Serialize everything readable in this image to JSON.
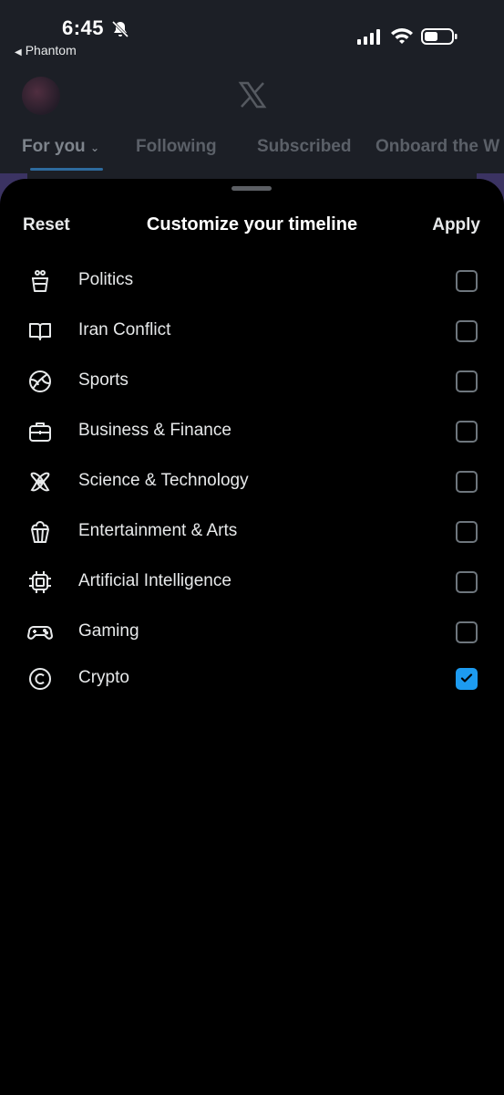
{
  "status_bar": {
    "time": "6:45",
    "back_app": "Phantom",
    "back_arrow": "◀"
  },
  "header": {
    "tabs": [
      "For you",
      "Following",
      "Subscribed",
      "Onboard the W"
    ],
    "active_tab": "For you"
  },
  "sheet": {
    "reset_label": "Reset",
    "title": "Customize your timeline",
    "apply_label": "Apply",
    "topics": [
      {
        "label": "Politics",
        "icon": "podium-icon",
        "checked": false
      },
      {
        "label": "Iran Conflict",
        "icon": "book-icon",
        "checked": false
      },
      {
        "label": "Sports",
        "icon": "ball-icon",
        "checked": false
      },
      {
        "label": "Business & Finance",
        "icon": "briefcase-icon",
        "checked": false
      },
      {
        "label": "Science & Technology",
        "icon": "atom-icon",
        "checked": false
      },
      {
        "label": "Entertainment & Arts",
        "icon": "popcorn-icon",
        "checked": false
      },
      {
        "label": "Artificial Intelligence",
        "icon": "chip-icon",
        "checked": false
      },
      {
        "label": "Gaming",
        "icon": "gamepad-icon",
        "checked": false
      },
      {
        "label": "Crypto",
        "icon": "crypto-coin-icon",
        "checked": true
      }
    ]
  },
  "colors": {
    "accent": "#1d9bf0",
    "sheet_bg": "#000000",
    "text": "#e7e9ea"
  }
}
